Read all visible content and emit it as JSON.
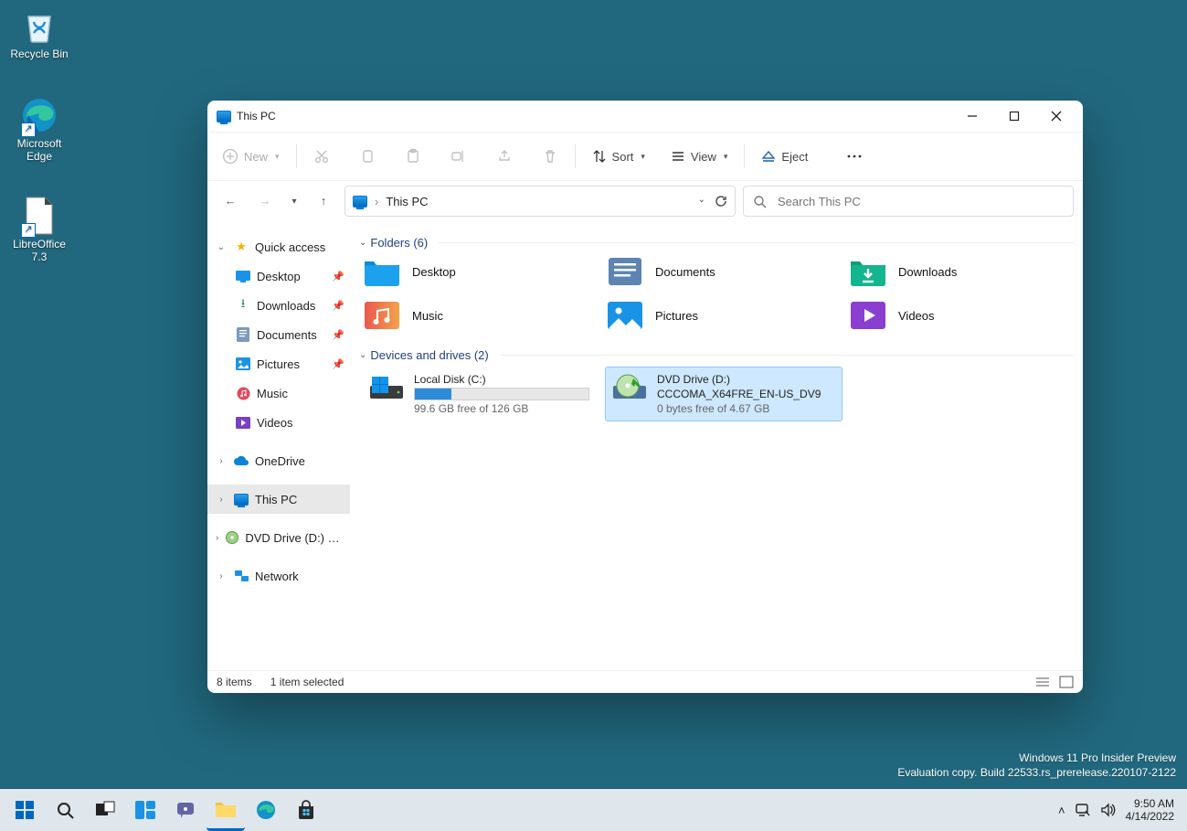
{
  "desktop": {
    "icons": [
      {
        "name": "recycle-bin",
        "label": "Recycle Bin"
      },
      {
        "name": "microsoft-edge",
        "label": "Microsoft\nEdge"
      },
      {
        "name": "libreoffice",
        "label": "LibreOffice\n7.3"
      }
    ],
    "watermark": {
      "line1": "Windows 11 Pro Insider Preview",
      "line2": "Evaluation copy. Build 22533.rs_prerelease.220107-2122"
    }
  },
  "window": {
    "title": "This PC",
    "toolbar": {
      "new": "New",
      "sort": "Sort",
      "view": "View",
      "eject": "Eject"
    },
    "address": {
      "location": "This PC"
    },
    "search": {
      "placeholder": "Search This PC"
    },
    "nav": {
      "quick_access": "Quick access",
      "items": [
        {
          "label": "Desktop",
          "pinned": true
        },
        {
          "label": "Downloads",
          "pinned": true
        },
        {
          "label": "Documents",
          "pinned": true
        },
        {
          "label": "Pictures",
          "pinned": true
        },
        {
          "label": "Music",
          "pinned": false
        },
        {
          "label": "Videos",
          "pinned": false
        }
      ],
      "onedrive": "OneDrive",
      "this_pc": "This PC",
      "dvd": "DVD Drive (D:) CCCOMA_X64FRE_EN-US_DV9",
      "network": "Network"
    },
    "sections": {
      "folders_head": "Folders (6)",
      "drives_head": "Devices and drives (2)",
      "folders": [
        {
          "label": "Desktop"
        },
        {
          "label": "Documents"
        },
        {
          "label": "Downloads"
        },
        {
          "label": "Music"
        },
        {
          "label": "Pictures"
        },
        {
          "label": "Videos"
        }
      ],
      "drives": {
        "local": {
          "title": "Local Disk (C:)",
          "free": "99.6 GB free of 126 GB",
          "pct_used": 21
        },
        "dvd": {
          "title": "DVD Drive (D:)",
          "label": "CCCOMA_X64FRE_EN-US_DV9",
          "free": "0 bytes free of 4.67 GB"
        }
      }
    },
    "status": {
      "count": "8 items",
      "selected": "1 item selected"
    }
  },
  "taskbar": {
    "time": "9:50 AM",
    "date": "4/14/2022"
  }
}
